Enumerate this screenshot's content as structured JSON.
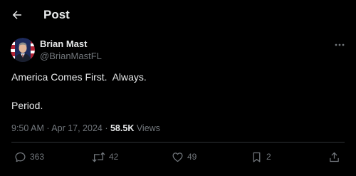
{
  "header": {
    "title": "Post",
    "back_icon": "arrow-left-icon"
  },
  "author": {
    "name": "Brian Mast",
    "handle": "@BrianMastFL",
    "avatar_icon": "avatar-photo"
  },
  "tweet": {
    "lines": [
      "America Comes First.  Always.",
      "Period."
    ]
  },
  "meta": {
    "timestamp": "9:50 AM · Apr 17, 2024 · ",
    "views_count": "58.5K",
    "views_label": " Views"
  },
  "actions": {
    "replies": "363",
    "reposts": "42",
    "likes": "49",
    "bookmarks": "2"
  },
  "colors": {
    "background": "#000000",
    "text": "#e7e9ea",
    "muted": "#71767b",
    "divider": "#2f3336"
  }
}
